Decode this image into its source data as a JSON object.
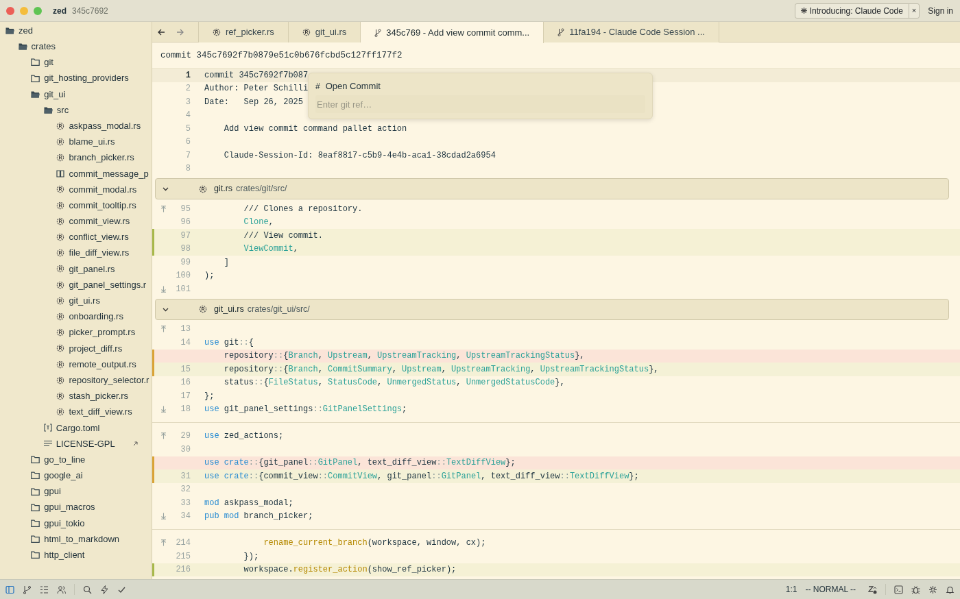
{
  "window": {
    "project": "zed",
    "branch": "345c7692",
    "announcement": "Introducing: Claude Code",
    "announcement_close": "×",
    "sign_in": "Sign in"
  },
  "sidebar": {
    "items": [
      {
        "label": "zed",
        "kind": "folder",
        "expanded": true,
        "children": [
          {
            "label": "crates",
            "kind": "folder",
            "expanded": true,
            "children": [
              {
                "label": "git",
                "kind": "folder",
                "expanded": false
              },
              {
                "label": "git_hosting_providers",
                "kind": "folder",
                "expanded": false
              },
              {
                "label": "git_ui",
                "kind": "folder",
                "expanded": true,
                "children": [
                  {
                    "label": "src",
                    "kind": "folder",
                    "expanded": true,
                    "children": [
                      {
                        "label": "askpass_modal.rs",
                        "kind": "rust"
                      },
                      {
                        "label": "blame_ui.rs",
                        "kind": "rust"
                      },
                      {
                        "label": "branch_picker.rs",
                        "kind": "rust"
                      },
                      {
                        "label": "commit_message_p",
                        "kind": "markdown"
                      },
                      {
                        "label": "commit_modal.rs",
                        "kind": "rust"
                      },
                      {
                        "label": "commit_tooltip.rs",
                        "kind": "rust"
                      },
                      {
                        "label": "commit_view.rs",
                        "kind": "rust"
                      },
                      {
                        "label": "conflict_view.rs",
                        "kind": "rust"
                      },
                      {
                        "label": "file_diff_view.rs",
                        "kind": "rust"
                      },
                      {
                        "label": "git_panel.rs",
                        "kind": "rust"
                      },
                      {
                        "label": "git_panel_settings.r",
                        "kind": "rust"
                      },
                      {
                        "label": "git_ui.rs",
                        "kind": "rust"
                      },
                      {
                        "label": "onboarding.rs",
                        "kind": "rust"
                      },
                      {
                        "label": "picker_prompt.rs",
                        "kind": "rust"
                      },
                      {
                        "label": "project_diff.rs",
                        "kind": "rust"
                      },
                      {
                        "label": "remote_output.rs",
                        "kind": "rust"
                      },
                      {
                        "label": "repository_selector.r",
                        "kind": "rust"
                      },
                      {
                        "label": "stash_picker.rs",
                        "kind": "rust"
                      },
                      {
                        "label": "text_diff_view.rs",
                        "kind": "rust"
                      }
                    ]
                  },
                  {
                    "label": "Cargo.toml",
                    "kind": "toml"
                  },
                  {
                    "label": "LICENSE-GPL",
                    "kind": "symlink"
                  }
                ]
              },
              {
                "label": "go_to_line",
                "kind": "folder",
                "expanded": false
              },
              {
                "label": "google_ai",
                "kind": "folder",
                "expanded": false
              },
              {
                "label": "gpui",
                "kind": "folder",
                "expanded": false
              },
              {
                "label": "gpui_macros",
                "kind": "folder",
                "expanded": false
              },
              {
                "label": "gpui_tokio",
                "kind": "folder",
                "expanded": false
              },
              {
                "label": "html_to_markdown",
                "kind": "folder",
                "expanded": false
              },
              {
                "label": "http_client",
                "kind": "folder",
                "expanded": false
              }
            ]
          }
        ]
      }
    ]
  },
  "tabs": [
    {
      "label": "ref_picker.rs",
      "kind": "file",
      "selected": false
    },
    {
      "label": "git_ui.rs",
      "kind": "file",
      "selected": false
    },
    {
      "label": "345c769 - Add view commit comm...",
      "kind": "commit",
      "selected": true
    },
    {
      "label": "11fa194 - Claude Code Session ...",
      "kind": "commit",
      "selected": false
    }
  ],
  "editor": {
    "commit_header": "commit 345c7692f7b0879e51c0b676fcbd5c127ff177f2",
    "sections": [
      {
        "kind": "message",
        "excerpts": [
          [
            {
              "number": "1",
              "kind": "context",
              "current": true,
              "tokens": [
                {
                  "kind": "plain",
                  "text": "commit 345c7692f7b087"
                }
              ]
            },
            {
              "number": "2",
              "kind": "context",
              "current": false,
              "tokens": [
                {
                  "kind": "plain",
                  "text": "Author: Peter Schilli"
                }
              ]
            },
            {
              "number": "3",
              "kind": "context",
              "current": false,
              "tokens": [
                {
                  "kind": "plain",
                  "text": "Date:   Sep 26, 2025"
                }
              ]
            },
            {
              "number": "4",
              "kind": "context",
              "current": false
            },
            {
              "number": "5",
              "kind": "context",
              "current": false,
              "tokens": [
                {
                  "kind": "plain",
                  "text": "    Add view commit command pallet action"
                }
              ]
            },
            {
              "number": "6",
              "kind": "context",
              "current": false
            },
            {
              "number": "7",
              "kind": "context",
              "current": false,
              "tokens": [
                {
                  "kind": "plain",
                  "text": "    Claude-Session-Id: 8eaf8817-c5b9-4e4b-aca1-38cdad2a6954"
                }
              ]
            },
            {
              "number": "8",
              "kind": "context",
              "current": false
            }
          ]
        ]
      },
      {
        "kind": "file",
        "file": "git.rs",
        "path": "crates/git/src/",
        "expanded": true,
        "excerpts": [
          [
            {
              "number": "95",
              "kind": "context",
              "current": false,
              "expand_up": true,
              "tokens": [
                {
                  "kind": "plain",
                  "text": "        /// Clones a repository."
                }
              ]
            },
            {
              "number": "96",
              "kind": "context",
              "current": false,
              "tokens": [
                {
                  "kind": "type",
                  "text": "        Clone"
                },
                {
                  "kind": "plain",
                  "text": ","
                }
              ]
            },
            {
              "number": "97",
              "kind": "added",
              "current": false,
              "tokens": [
                {
                  "kind": "plain",
                  "text": "        /// View commit."
                }
              ]
            },
            {
              "number": "98",
              "kind": "added",
              "current": false,
              "tokens": [
                {
                  "kind": "type",
                  "text": "        ViewCommit"
                },
                {
                  "kind": "plain",
                  "text": ","
                }
              ]
            },
            {
              "number": "99",
              "kind": "context",
              "current": false,
              "tokens": [
                {
                  "kind": "plain",
                  "text": "    ]"
                }
              ]
            },
            {
              "number": "100",
              "kind": "context",
              "current": false,
              "tokens": [
                {
                  "kind": "plain",
                  "text": ");"
                }
              ]
            },
            {
              "number": "101",
              "kind": "context",
              "current": false,
              "expand_down": true
            }
          ]
        ]
      },
      {
        "kind": "file",
        "file": "git_ui.rs",
        "path": "crates/git_ui/src/",
        "expanded": true,
        "excerpts": [
          [
            {
              "number": "13",
              "kind": "context",
              "current": false,
              "expand_up": true
            },
            {
              "number": "14",
              "kind": "context",
              "current": false,
              "tokens": [
                {
                  "kind": "keyword",
                  "text": "use"
                },
                {
                  "kind": "plain",
                  "text": " git"
                },
                {
                  "kind": "operator",
                  "text": "::"
                },
                {
                  "kind": "plain",
                  "text": "{"
                }
              ]
            },
            {
              "kind": "removed",
              "current": false,
              "tokens": [
                {
                  "kind": "plain",
                  "text": "    repository"
                },
                {
                  "kind": "operator",
                  "text": "::"
                },
                {
                  "kind": "plain",
                  "text": "{"
                },
                {
                  "kind": "type",
                  "text": "Branch"
                },
                {
                  "kind": "plain",
                  "text": ", "
                },
                {
                  "kind": "type",
                  "text": "Upstream"
                },
                {
                  "kind": "plain",
                  "text": ", "
                },
                {
                  "kind": "type",
                  "text": "UpstreamTracking"
                },
                {
                  "kind": "plain",
                  "text": ", "
                },
                {
                  "kind": "type",
                  "text": "UpstreamTrackingStatus"
                },
                {
                  "kind": "plain",
                  "text": "},"
                }
              ]
            },
            {
              "number": "15",
              "kind": "modified",
              "current": false,
              "tokens": [
                {
                  "kind": "plain",
                  "text": "    repository"
                },
                {
                  "kind": "operator",
                  "text": "::"
                },
                {
                  "kind": "plain",
                  "text": "{"
                },
                {
                  "kind": "type",
                  "text": "Branch"
                },
                {
                  "kind": "plain",
                  "text": ", "
                },
                {
                  "kind": "type",
                  "text": "CommitSummary"
                },
                {
                  "kind": "plain",
                  "text": ", "
                },
                {
                  "kind": "type",
                  "text": "Upstream"
                },
                {
                  "kind": "plain",
                  "text": ", "
                },
                {
                  "kind": "type",
                  "text": "UpstreamTracking"
                },
                {
                  "kind": "plain",
                  "text": ", "
                },
                {
                  "kind": "type",
                  "text": "UpstreamTrackingStatus"
                },
                {
                  "kind": "plain",
                  "text": "},"
                }
              ]
            },
            {
              "number": "16",
              "kind": "context",
              "current": false,
              "tokens": [
                {
                  "kind": "plain",
                  "text": "    status"
                },
                {
                  "kind": "operator",
                  "text": "::"
                },
                {
                  "kind": "plain",
                  "text": "{"
                },
                {
                  "kind": "type",
                  "text": "FileStatus"
                },
                {
                  "kind": "plain",
                  "text": ", "
                },
                {
                  "kind": "type",
                  "text": "StatusCode"
                },
                {
                  "kind": "plain",
                  "text": ", "
                },
                {
                  "kind": "type",
                  "text": "UnmergedStatus"
                },
                {
                  "kind": "plain",
                  "text": ", "
                },
                {
                  "kind": "type",
                  "text": "UnmergedStatusCode"
                },
                {
                  "kind": "plain",
                  "text": "},"
                }
              ]
            },
            {
              "number": "17",
              "kind": "context",
              "current": false,
              "tokens": [
                {
                  "kind": "plain",
                  "text": "};"
                }
              ]
            },
            {
              "number": "18",
              "kind": "context",
              "current": false,
              "expand_down": true,
              "tokens": [
                {
                  "kind": "keyword",
                  "text": "use"
                },
                {
                  "kind": "plain",
                  "text": " git_panel_settings"
                },
                {
                  "kind": "operator",
                  "text": "::"
                },
                {
                  "kind": "type",
                  "text": "GitPanelSettings"
                },
                {
                  "kind": "plain",
                  "text": ";"
                }
              ]
            }
          ],
          [
            {
              "number": "29",
              "kind": "context",
              "current": false,
              "expand_up": true,
              "tokens": [
                {
                  "kind": "keyword",
                  "text": "use"
                },
                {
                  "kind": "plain",
                  "text": " zed_actions;"
                }
              ]
            },
            {
              "number": "30",
              "kind": "context",
              "current": false
            },
            {
              "kind": "removed",
              "current": false,
              "tokens": [
                {
                  "kind": "keyword",
                  "text": "use crate"
                },
                {
                  "kind": "operator",
                  "text": "::"
                },
                {
                  "kind": "plain",
                  "text": "{git_panel"
                },
                {
                  "kind": "operator",
                  "text": "::"
                },
                {
                  "kind": "type",
                  "text": "GitPanel"
                },
                {
                  "kind": "plain",
                  "text": ", text_diff_view"
                },
                {
                  "kind": "operator",
                  "text": "::"
                },
                {
                  "kind": "type",
                  "text": "TextDiffView"
                },
                {
                  "kind": "plain",
                  "text": "};"
                }
              ]
            },
            {
              "number": "31",
              "kind": "modified",
              "current": false,
              "tokens": [
                {
                  "kind": "keyword",
                  "text": "use crate"
                },
                {
                  "kind": "operator",
                  "text": "::"
                },
                {
                  "kind": "plain",
                  "text": "{commit_view"
                },
                {
                  "kind": "operator",
                  "text": "::"
                },
                {
                  "kind": "type",
                  "text": "CommitView"
                },
                {
                  "kind": "plain",
                  "text": ", git_panel"
                },
                {
                  "kind": "operator",
                  "text": "::"
                },
                {
                  "kind": "type",
                  "text": "GitPanel"
                },
                {
                  "kind": "plain",
                  "text": ", text_diff_view"
                },
                {
                  "kind": "operator",
                  "text": "::"
                },
                {
                  "kind": "type",
                  "text": "TextDiffView"
                },
                {
                  "kind": "plain",
                  "text": "};"
                }
              ]
            },
            {
              "number": "32",
              "kind": "context",
              "current": false
            },
            {
              "number": "33",
              "kind": "context",
              "current": false,
              "tokens": [
                {
                  "kind": "keyword",
                  "text": "mod"
                },
                {
                  "kind": "plain",
                  "text": " askpass_modal;"
                }
              ]
            },
            {
              "number": "34",
              "kind": "context",
              "current": false,
              "expand_down": true,
              "tokens": [
                {
                  "kind": "keyword",
                  "text": "pub mod"
                },
                {
                  "kind": "plain",
                  "text": " branch_picker;"
                }
              ]
            }
          ],
          [
            {
              "number": "214",
              "kind": "context",
              "current": false,
              "expand_up": true,
              "tokens": [
                {
                  "kind": "function",
                  "text": "            rename_current_branch"
                },
                {
                  "kind": "plain",
                  "text": "(workspace, window, cx);"
                }
              ]
            },
            {
              "number": "215",
              "kind": "context",
              "current": false,
              "tokens": [
                {
                  "kind": "plain",
                  "text": "        });"
                }
              ]
            },
            {
              "number": "216",
              "kind": "added",
              "current": false,
              "tokens": [
                {
                  "kind": "plain",
                  "text": "        workspace."
                },
                {
                  "kind": "function",
                  "text": "register_action"
                },
                {
                  "kind": "plain",
                  "text": "(show_ref_picker);"
                }
              ]
            }
          ]
        ]
      }
    ]
  },
  "popup": {
    "symbol": "#",
    "title": "Open Commit",
    "placeholder": "Enter git ref…"
  },
  "status_bar": {
    "position": "1:1",
    "mode": "-- NORMAL --"
  }
}
